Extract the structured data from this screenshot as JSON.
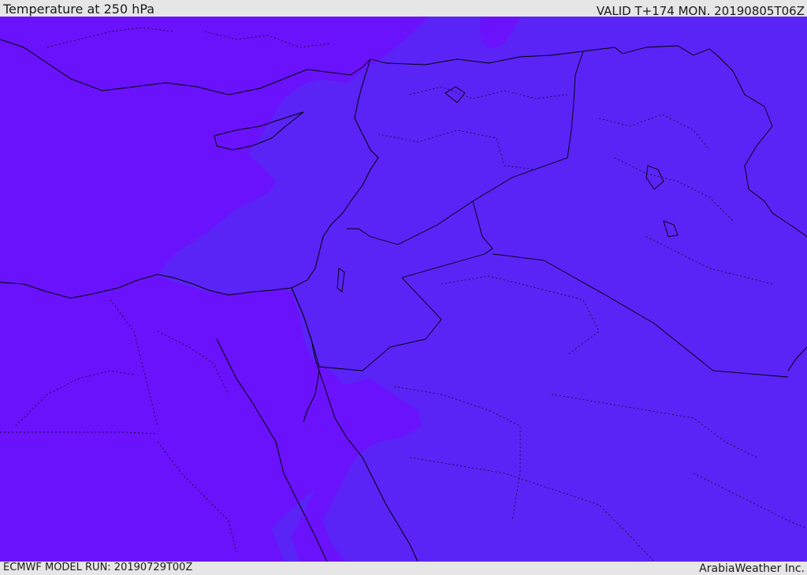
{
  "header": {
    "title": "Temperature at 250 hPa",
    "valid_time": "VALID T+174 MON. 20190805T06Z"
  },
  "footer": {
    "model_run": "ECMWF MODEL RUN: 20190729T00Z",
    "credit": "ArabiaWeather Inc."
  },
  "map": {
    "colors": {
      "warm_band": "#6a12fb",
      "cool_band": "#5a24f6",
      "coastline": "#000000"
    }
  }
}
